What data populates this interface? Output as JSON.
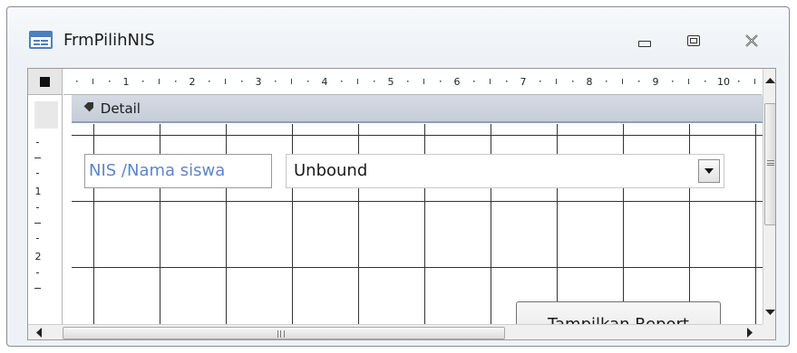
{
  "window": {
    "title": "FrmPilihNIS",
    "icon": "form-icon",
    "controls": [
      "minimize-icon",
      "maximize-icon",
      "close-icon"
    ]
  },
  "ruler": {
    "horizontal_marks": [
      "1",
      "2",
      "3",
      "4",
      "5",
      "6",
      "7",
      "8",
      "9",
      "10"
    ],
    "vertical_marks": [
      "1",
      "2"
    ]
  },
  "section": {
    "label": "Detail",
    "icon": "section-arrow-icon"
  },
  "form": {
    "label_text": "NIS /Nama siswa",
    "combo_value": "Unbound",
    "command_label": "Tampilkan Report"
  },
  "colors": {
    "label_text": "#5b86c8",
    "section_bar": "#ccd4de",
    "grid_line": "#333333"
  }
}
